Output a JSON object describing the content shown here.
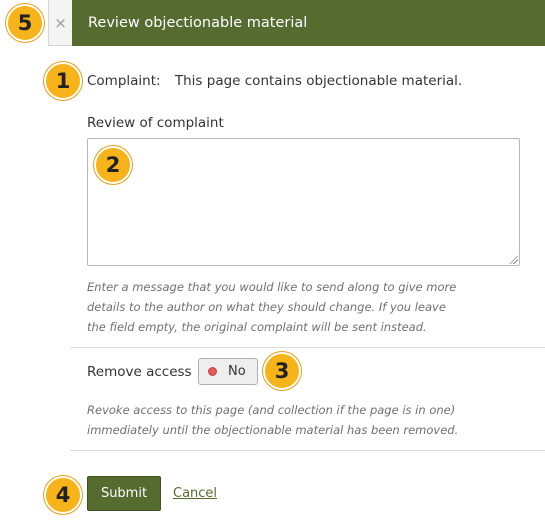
{
  "dialog": {
    "title": "Review objectionable material",
    "close_glyph": "×"
  },
  "complaint": {
    "label": "Complaint:",
    "text": "This page contains objectionable material."
  },
  "review": {
    "label": "Review of complaint",
    "value": "",
    "help": "Enter a message that you would like to send along to give more details to the author on what they should change. If you leave the field empty, the original complaint will be sent instead."
  },
  "remove_access": {
    "label": "Remove access",
    "toggle_text": "No",
    "help": "Revoke access to this page (and collection if the page is in one) immediately until the objectionable material has been removed."
  },
  "actions": {
    "submit": "Submit",
    "cancel": "Cancel"
  },
  "callouts": [
    "1",
    "2",
    "3",
    "4",
    "5"
  ],
  "colors": {
    "title_bar": "#556b2f",
    "callout": "#f6b31b",
    "toggle_off_dot": "#e05a5a",
    "link": "#556b2f"
  },
  "icons": {
    "close": "close-icon",
    "toggle_indicator": "status-dot-icon",
    "resize": "resize-grip-icon"
  }
}
